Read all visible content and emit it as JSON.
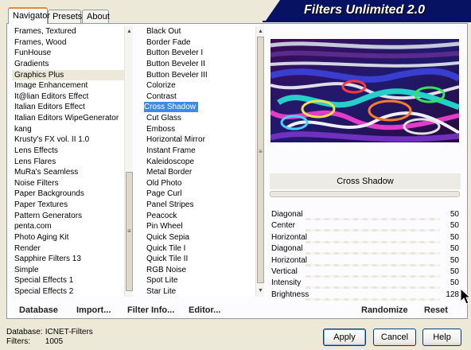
{
  "tabs": [
    {
      "label": "Navigator",
      "active": true
    },
    {
      "label": "Presets",
      "active": false
    },
    {
      "label": "About",
      "active": false
    }
  ],
  "banner_title": "Filters Unlimited 2.0",
  "categories": {
    "items": [
      "Frames, Textured",
      "Frames, Wood",
      "FunHouse",
      "Gradients",
      "Graphics Plus",
      "Image Enhancement",
      "It@lian Editors Effect",
      "Italian Editors Effect",
      "Italian Editors WipeGenerator",
      "kang",
      "Krusty's FX vol. II 1.0",
      "Lens Effects",
      "Lens Flares",
      "MuRa's Seamless",
      "Noise Filters",
      "Paper Backgrounds",
      "Paper Textures",
      "Pattern Generators",
      "penta.com",
      "Photo Aging Kit",
      "Render",
      "Sapphire Filters 13",
      "Simple",
      "Special Effects 1",
      "Special Effects 2"
    ],
    "highlighted": "Graphics Plus"
  },
  "filters": {
    "items": [
      "Black Out",
      "Border Fade",
      "Button Beveler I",
      "Button Beveler II",
      "Button Beveler III",
      "Colorize",
      "Contrast",
      "Cross Shadow",
      "Cut Glass",
      "Emboss",
      "Horizontal Mirror",
      "Instant Frame",
      "Kaleidoscope",
      "Metal Border",
      "Old Photo",
      "Page Curl",
      "Panel Stripes",
      "Peacock",
      "Pin Wheel",
      "Quick Sepia",
      "Quick Tile I",
      "Quick Tile II",
      "RGB Noise",
      "Spot Lite",
      "Star Lite"
    ],
    "selected": "Cross Shadow"
  },
  "scroll_glyph": "≡",
  "panel_buttons": {
    "database": "Database",
    "import": "Import...",
    "filter_info": "Filter Info...",
    "editor": "Editor...",
    "randomize": "Randomize",
    "reset": "Reset"
  },
  "current_filter": "Cross Shadow",
  "parameters": [
    {
      "name": "Diagonal",
      "value": "50"
    },
    {
      "name": "Center",
      "value": "50"
    },
    {
      "name": "Horizontal",
      "value": "50"
    },
    {
      "name": "Diagonal",
      "value": "50"
    },
    {
      "name": "Horizontal",
      "value": "50"
    },
    {
      "name": "Vertical",
      "value": "50"
    },
    {
      "name": "Intensity",
      "value": "50"
    },
    {
      "name": "Brightness",
      "value": "128"
    }
  ],
  "status": {
    "database_label": "Database:",
    "database_value": "ICNET-Filters",
    "filters_label": "Filters:",
    "filters_value": "1005"
  },
  "dialog_buttons": {
    "apply": "Apply",
    "cancel": "Cancel",
    "help": "Help"
  },
  "colors": {
    "banner": "#071262",
    "selection": "#3d8be4",
    "active_tab_accent": "#e68b2c"
  }
}
